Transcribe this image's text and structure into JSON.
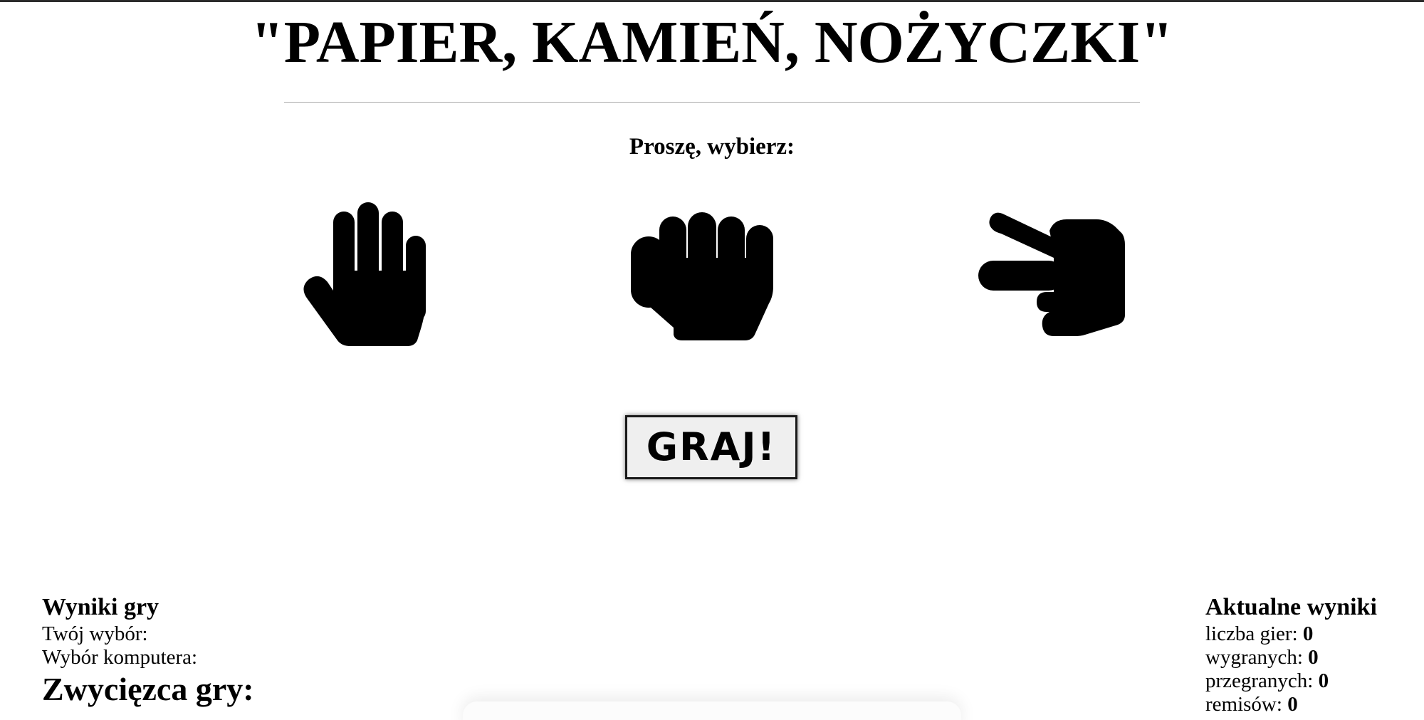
{
  "title": "\"PAPIER, KAMIEŃ, NOŻYCZKI\"",
  "prompt": "Proszę, wybierz:",
  "choices": [
    {
      "id": "paper",
      "icon": "hand-paper-icon"
    },
    {
      "id": "rock",
      "icon": "hand-rock-icon"
    },
    {
      "id": "scissors",
      "icon": "hand-scissors-icon"
    }
  ],
  "play_button": "GRAJ!",
  "game_results": {
    "heading": "Wyniki gry",
    "your_choice_label": "Twój wybór:",
    "computer_choice_label": "Wybór komputera:",
    "winner_label": "Zwycięzca gry:"
  },
  "current_results": {
    "heading": "Aktualne wyniki",
    "games_label": "liczba gier:",
    "games_value": "0",
    "wins_label": "wygranych:",
    "wins_value": "0",
    "losses_label": "przegranych:",
    "losses_value": "0",
    "draws_label": "remisów:",
    "draws_value": "0"
  }
}
